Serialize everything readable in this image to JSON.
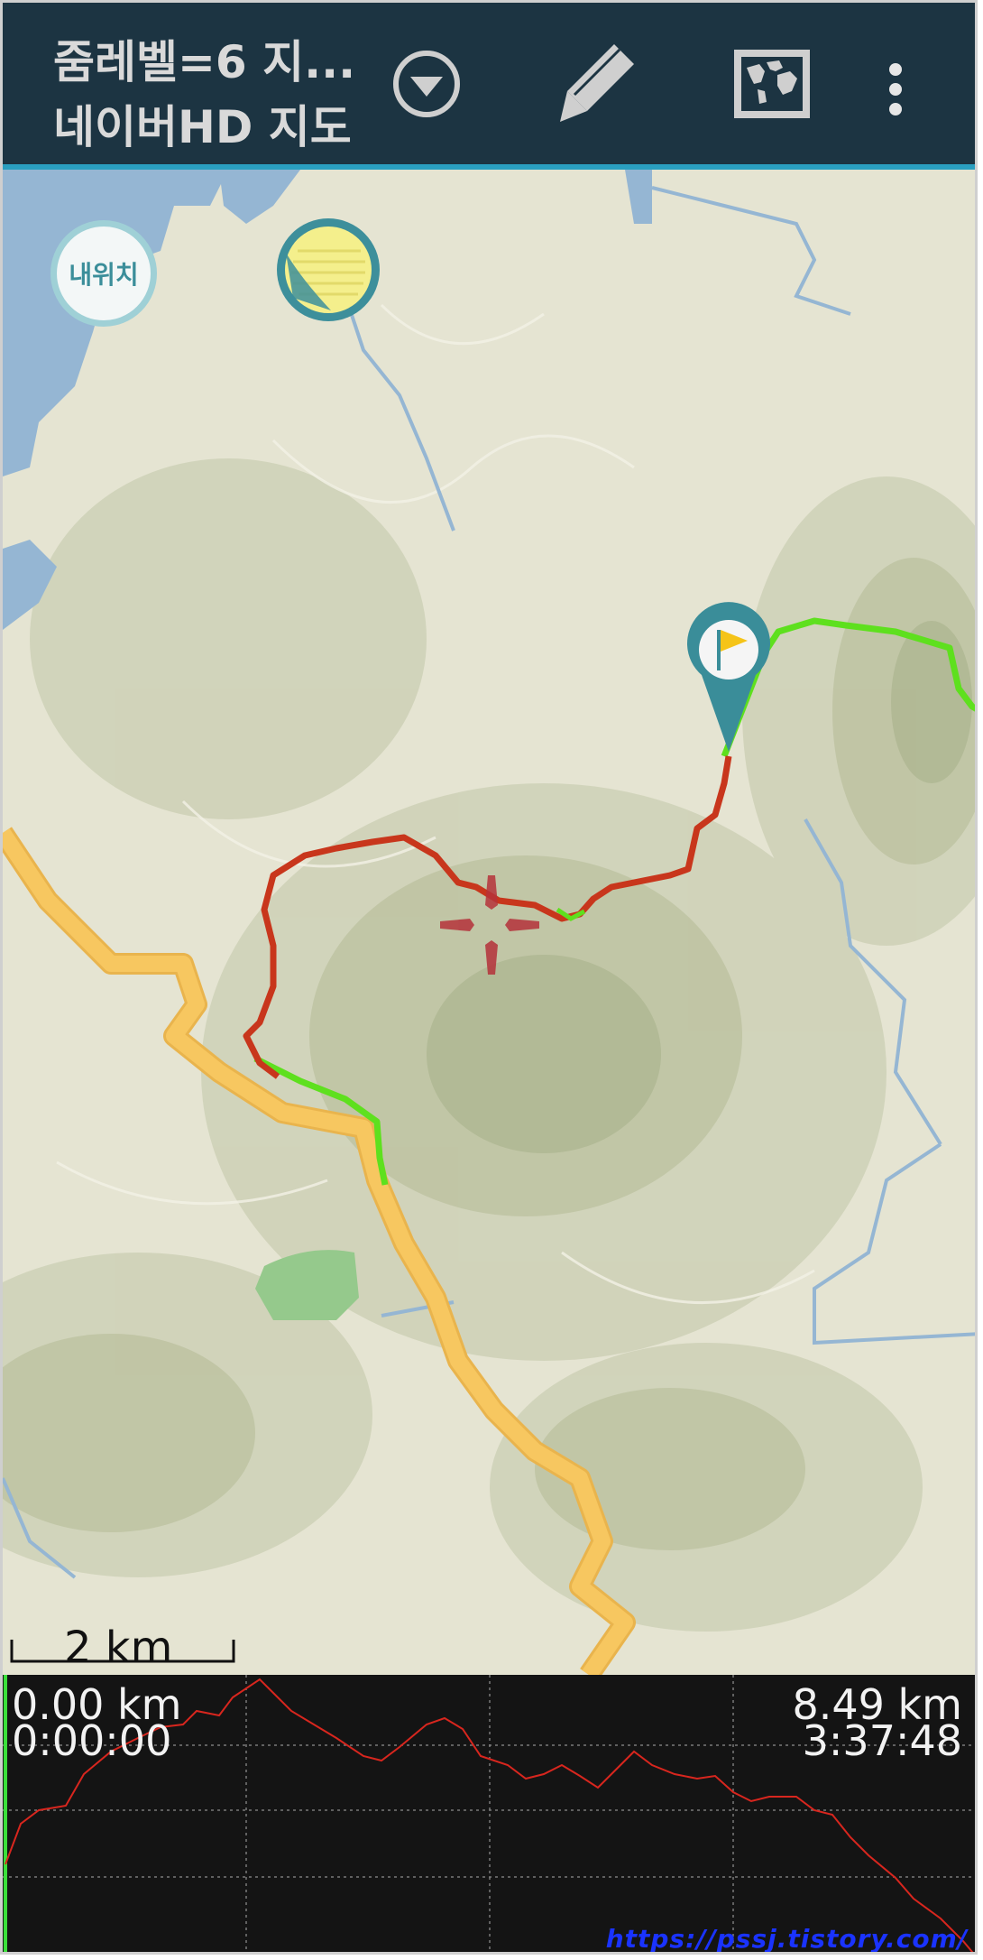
{
  "header": {
    "title_line1": "줌레벨=6 지...",
    "title_line2": "네이버HD 지도",
    "icons": [
      "dropdown-circle-icon",
      "pencil-icon",
      "world-map-icon",
      "more-vert-icon"
    ]
  },
  "map": {
    "my_location_label": "내위치",
    "scale_label": "2 km",
    "colors": {
      "road": "#f7c760",
      "water": "#95b6d3",
      "track_red": "#c8361c",
      "track_green": "#5ee01e",
      "marker": "#3a8d99",
      "flag": "#f5c418"
    }
  },
  "graph": {
    "start_distance": "0.00 km",
    "start_time": "0:00:00",
    "end_distance": "8.49 km",
    "end_time": "3:37:48"
  },
  "watermark": "https://pssj.tistory.com/"
}
